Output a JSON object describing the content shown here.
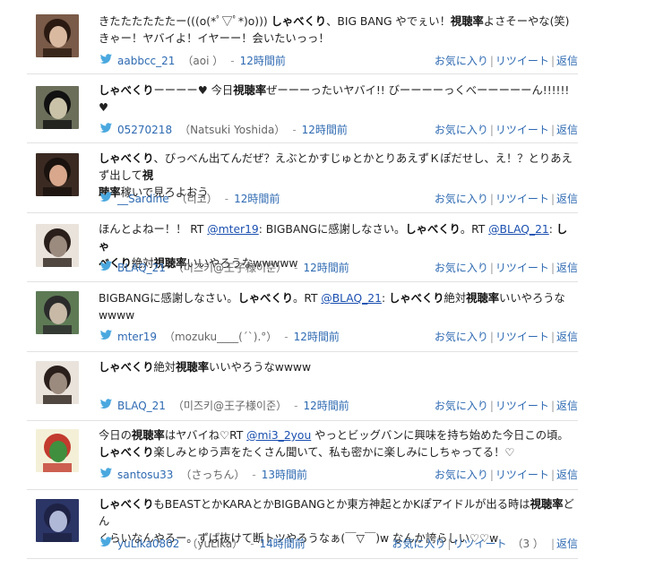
{
  "actions": {
    "fav": "お気に入り",
    "rt": "リツイート",
    "reply": "返信",
    "sep": "|"
  },
  "tweets": [
    {
      "lines": [
        [
          {
            "t": "きたたたたたたー(((o(*ﾟ▽ﾟ*)o))) "
          },
          {
            "t": "しゃべくり",
            "b": 1
          },
          {
            "t": "、BIG BANG やでぇい！"
          },
          {
            "t": "視聴率",
            "b": 1
          },
          {
            "t": "よさそーやな(笑)"
          }
        ],
        [
          {
            "t": "きゃー！ヤバイよ！イヤーー！会いたいっっ！"
          }
        ]
      ],
      "user": "aabbcc_21",
      "name": "（aoi ）",
      "sep": "-",
      "time": "12時間前"
    },
    {
      "lines": [
        [
          {
            "t": "しゃべくり",
            "b": 1
          },
          {
            "t": "ーーーー♥ 今日"
          },
          {
            "t": "視聴率",
            "b": 1
          },
          {
            "t": "ぜーーーったいヤバイ!! びーーーーっくべーーーーーん!!!!!!♥"
          }
        ]
      ],
      "user": "05270218",
      "name": "（Natsuki Yoshida）",
      "sep": "-",
      "time": "12時間前"
    },
    {
      "lines": [
        [
          {
            "t": "しゃべくり",
            "b": 1
          },
          {
            "t": "、びっべん出てんだぜ？えぶとかすじゅとかとりあえずＫぽだせし、え！？とりあえず出して"
          },
          {
            "t": "視",
            "b": 1
          }
        ],
        [
          {
            "t": "聴率",
            "b": 1
          },
          {
            "t": "稼いで見ろよおう"
          }
        ]
      ],
      "user": "__Sardine",
      "name": "（리코）",
      "sep": "-",
      "time": "12時間前"
    },
    {
      "lines": [
        [
          {
            "t": "ほんとよねー！！ RT "
          },
          {
            "t": "@mter19",
            "a": 1
          },
          {
            "t": ": BIGBANGに感謝しなさい。"
          },
          {
            "t": "しゃべくり",
            "b": 1
          },
          {
            "t": "。RT "
          },
          {
            "t": "@BLAQ_21",
            "a": 1
          },
          {
            "t": ": "
          },
          {
            "t": "しゃ",
            "b": 1
          }
        ],
        [
          {
            "t": "べくり",
            "b": 1
          },
          {
            "t": "絶対"
          },
          {
            "t": "視聴率",
            "b": 1
          },
          {
            "t": "いいやろうなwwwww"
          }
        ]
      ],
      "user": "BLAQ_21",
      "name": "（미즈키@王子様이준）",
      "sep": "-",
      "time": "12時間前"
    },
    {
      "lines": [
        [
          {
            "t": "BIGBANGに感謝しなさい。"
          },
          {
            "t": "しゃべくり",
            "b": 1
          },
          {
            "t": "。RT "
          },
          {
            "t": "@BLAQ_21",
            "a": 1
          },
          {
            "t": ": "
          },
          {
            "t": "しゃべくり",
            "b": 1
          },
          {
            "t": "絶対"
          },
          {
            "t": "視聴率",
            "b": 1
          },
          {
            "t": "いいやろうな"
          }
        ],
        [
          {
            "t": "wwww"
          }
        ]
      ],
      "user": "mter19",
      "name": "（mozuku____(´`).°）",
      "sep": "-",
      "time": "12時間前"
    },
    {
      "lines": [
        [
          {
            "t": "しゃべくり",
            "b": 1
          },
          {
            "t": "絶対"
          },
          {
            "t": "視聴率",
            "b": 1
          },
          {
            "t": "いいやろうなwwww"
          }
        ]
      ],
      "user": "BLAQ_21",
      "name": "（미즈키@王子様이준）",
      "sep": "-",
      "time": "12時間前"
    },
    {
      "lines": [
        [
          {
            "t": "今日の"
          },
          {
            "t": "視聴率",
            "b": 1
          },
          {
            "t": "はヤバイね♡RT "
          },
          {
            "t": "@mi3_2you",
            "a": 1
          },
          {
            "t": " やっとビッグバンに興味を持ち始めた今日この頃。"
          }
        ],
        [
          {
            "t": "しゃべくり",
            "b": 1
          },
          {
            "t": "楽しみとゆう声をたくさん聞いて、私も密かに楽しみにしちゃってる！♡"
          }
        ]
      ],
      "user": "santosu33",
      "name": "（さっちん）",
      "sep": "-",
      "time": "13時間前"
    },
    {
      "lines": [
        [
          {
            "t": "しゃべくり",
            "b": 1
          },
          {
            "t": "もBEASTとかKARAとかBIGBANGとか東方神起とかKぽアイドルが出る時は"
          },
          {
            "t": "視聴率",
            "b": 1
          },
          {
            "t": "どん"
          }
        ],
        [
          {
            "t": "くらいなんやろー。ずば抜けて断トツやろうなぁ(￣▽￣)w なんか誇らしい♡♡w"
          }
        ]
      ],
      "user": "yuLika0802",
      "name": "（yuLika）",
      "sep": "-",
      "time": "14時間前",
      "rt_count": "（3 ）"
    }
  ],
  "colors": {
    "link": "#1a4fb0",
    "meta": "#2e6ab2",
    "bird": "#4aa8df",
    "divider": "#e2e2e2"
  }
}
